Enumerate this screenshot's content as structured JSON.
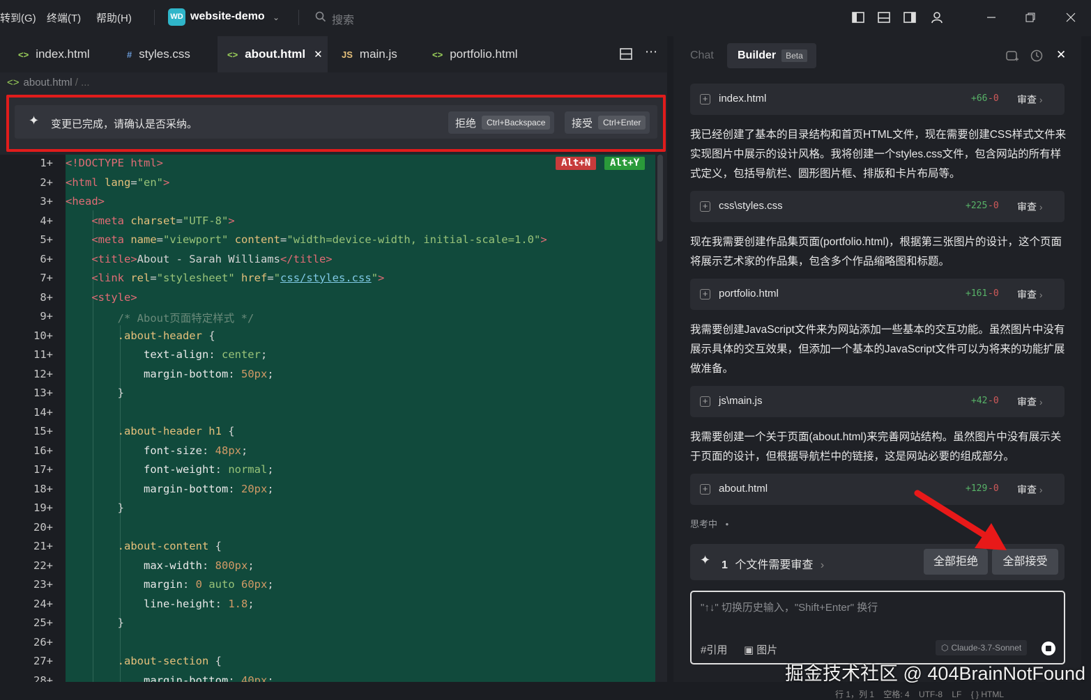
{
  "menu": {
    "goto": "转到(G)",
    "terminal": "终端(T)",
    "help": "帮助(H)"
  },
  "project": {
    "badge": "WD",
    "name": "website-demo"
  },
  "search": {
    "placeholder": "搜索"
  },
  "tabs": [
    {
      "icon": "<>",
      "label": "index.html"
    },
    {
      "icon": "#",
      "label": "styles.css"
    },
    {
      "icon": "<>",
      "label": "about.html"
    },
    {
      "icon": "JS",
      "label": "main.js"
    },
    {
      "icon": "<>",
      "label": "portfolio.html"
    }
  ],
  "breadcrumb": {
    "file": "about.html",
    "rest": "/ ..."
  },
  "diff_bar": {
    "message": "变更已完成，请确认是否采纳。",
    "reject": "拒绝",
    "reject_key": "Ctrl+Backspace",
    "accept": "接受",
    "accept_key": "Ctrl+Enter"
  },
  "inline_keys": {
    "reject": "Alt+N",
    "accept": "Alt+Y"
  },
  "code_lines": [
    "1+",
    "2+",
    "3+",
    "4+",
    "5+",
    "6+",
    "7+",
    "8+",
    "9+",
    "10+",
    "11+",
    "12+",
    "13+",
    "14+",
    "15+",
    "16+",
    "17+",
    "18+",
    "19+",
    "20+",
    "21+",
    "22+",
    "23+",
    "24+",
    "25+",
    "26+",
    "27+",
    "28+"
  ],
  "chat": {
    "tab_chat": "Chat",
    "tab_builder": "Builder",
    "beta": "Beta",
    "files": [
      {
        "name": "index.html",
        "added": "+66",
        "removed": "-0",
        "review": "审查"
      },
      {
        "name": "css\\styles.css",
        "added": "+225",
        "removed": "-0",
        "review": "审查"
      },
      {
        "name": "portfolio.html",
        "added": "+161",
        "removed": "-0",
        "review": "审查"
      },
      {
        "name": "js\\main.js",
        "added": "+42",
        "removed": "-0",
        "review": "审查"
      },
      {
        "name": "about.html",
        "added": "+129",
        "removed": "-0",
        "review": "审查"
      }
    ],
    "messages": [
      "我已经创建了基本的目录结构和首页HTML文件，现在需要创建CSS样式文件来实现图片中展示的设计风格。我将创建一个styles.css文件，包含网站的所有样式定义，包括导航栏、圆形图片框、排版和卡片布局等。",
      "现在我需要创建作品集页面(portfolio.html)，根据第三张图片的设计，这个页面将展示艺术家的作品集，包含多个作品缩略图和标题。",
      "我需要创建JavaScript文件来为网站添加一些基本的交互功能。虽然图片中没有展示具体的交互效果，但添加一个基本的JavaScript文件可以为将来的功能扩展做准备。",
      "我需要创建一个关于页面(about.html)来完善网站结构。虽然图片中没有展示关于页面的设计，但根据导航栏中的链接，这是网站必要的组成部分。"
    ],
    "thinking": "思考中",
    "pending": {
      "count": "1",
      "text": "个文件需要审查",
      "reject_all": "全部拒绝",
      "accept_all": "全部接受"
    },
    "input": {
      "placeholder": "\"↑↓\" 切换历史输入，\"Shift+Enter\" 换行",
      "cite": "#引用",
      "image": "图片",
      "model": "Claude-3.7-Sonnet"
    }
  },
  "watermark": "掘金技术社区 @ 404BrainNotFound",
  "status": "行 1，列 1    空格: 4    UTF-8    LF    { } HTML",
  "colors": {
    "accent_red": "#e01c1c",
    "diff_green": "#114a3c",
    "added": "#58b368",
    "removed": "#d05a5a"
  }
}
